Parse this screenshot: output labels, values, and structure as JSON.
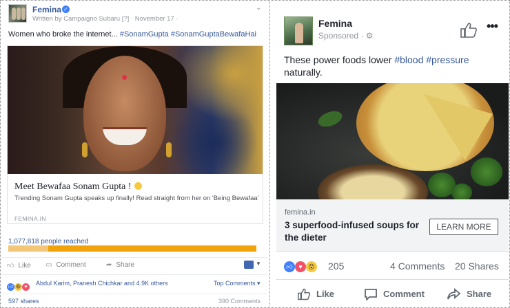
{
  "left_post": {
    "page_name": "Femina",
    "meta": "Written by Campaigno Subaru [?] · November 17 ·",
    "text_plain": "Women who broke the internet... ",
    "text_tags": "#SonamGupta #SonamGuptaBewafaHai",
    "card": {
      "title": "Meet Bewafaa Sonam Gupta !",
      "description": "Trending Sonam Gupta speaks up finally! Read straight from her on 'Being Bewafaa'",
      "source": "FEMINA.IN"
    },
    "reach": "1,077,818 people reached",
    "reach_bar": {
      "organic_fraction": 0.16,
      "organic_color": "#f2c77a",
      "paid_color": "#f0a30a"
    },
    "actions": {
      "like": "Like",
      "comment": "Comment",
      "share": "Share"
    },
    "reactions_names": "Abdul Karim, Pranesh Chichkar and 4.9K others",
    "top_comments": "Top Comments ▾",
    "shares": "597 shares",
    "comments": "390 Comments"
  },
  "right_post": {
    "page_name": "Femina",
    "sponsored": "Sponsored · ",
    "text_plain": "These power foods lower ",
    "text_tag1": "#blood",
    "text_tag2": "#pressure",
    "text_after": "naturally.",
    "link": {
      "domain": "femina.in",
      "title": "3 superfood-infused soups for the dieter",
      "cta": "LEARN MORE"
    },
    "reaction_count": "205",
    "comments": "4 Comments",
    "shares": "20 Shares",
    "actions": {
      "like": "Like",
      "comment": "Comment",
      "share": "Share"
    }
  },
  "colors": {
    "link": "#365899",
    "fb_blue": "#4267b2",
    "like_blue": "#4080ff",
    "love_red": "#f25268",
    "wow_yellow": "#f7c940"
  },
  "icons": [
    "verified-badge-icon",
    "globe-icon",
    "like-icon",
    "comment-icon",
    "share-icon",
    "more-icon",
    "caret-down-icon"
  ]
}
